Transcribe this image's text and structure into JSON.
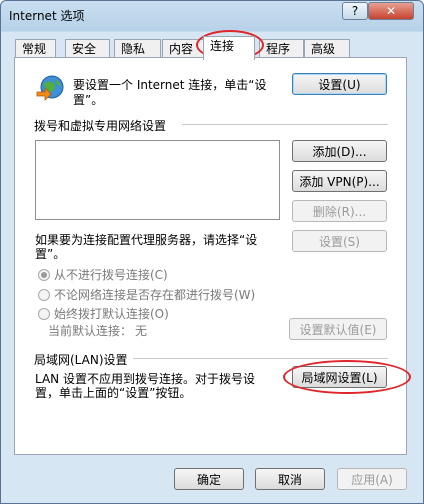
{
  "window": {
    "title": "Internet 选项",
    "help_label": "?",
    "close_label": "✕"
  },
  "tabs": [
    {
      "label": "常规"
    },
    {
      "label": "安全"
    },
    {
      "label": "隐私"
    },
    {
      "label": "内容"
    },
    {
      "label": "连接"
    },
    {
      "label": "程序"
    },
    {
      "label": "高级"
    }
  ],
  "setup": {
    "text_line1": "要设置一个 Internet 连接，单击“设",
    "text_line2": "置”。",
    "button": "设置(U)"
  },
  "dialup": {
    "heading": "拨号和虚拟专用网络设置",
    "add_button": "添加(D)...",
    "add_vpn_button": "添加 VPN(P)...",
    "remove_button": "删除(R)...",
    "proxy_text_line1": "如果要为连接配置代理服务器，请选择“设",
    "proxy_text_line2": "置”。",
    "settings_button": "设置(S)",
    "radio_never": "从不进行拨号连接(C)",
    "radio_when_none": "不论网络连接是否存在都进行拨号(W)",
    "radio_always": "始终拨打默认连接(O)",
    "current_default_label": "当前默认连接：",
    "current_default_value": "无",
    "set_default_button": "设置默认值(E)"
  },
  "lan": {
    "heading": "局域网(LAN)设置",
    "text_line1": "LAN 设置不应用到拨号连接。对于拨号设",
    "text_line2": "置，单击上面的“设置”按钮。",
    "button": "局域网设置(L)"
  },
  "footer": {
    "ok": "确定",
    "cancel": "取消",
    "apply": "应用(A)"
  }
}
